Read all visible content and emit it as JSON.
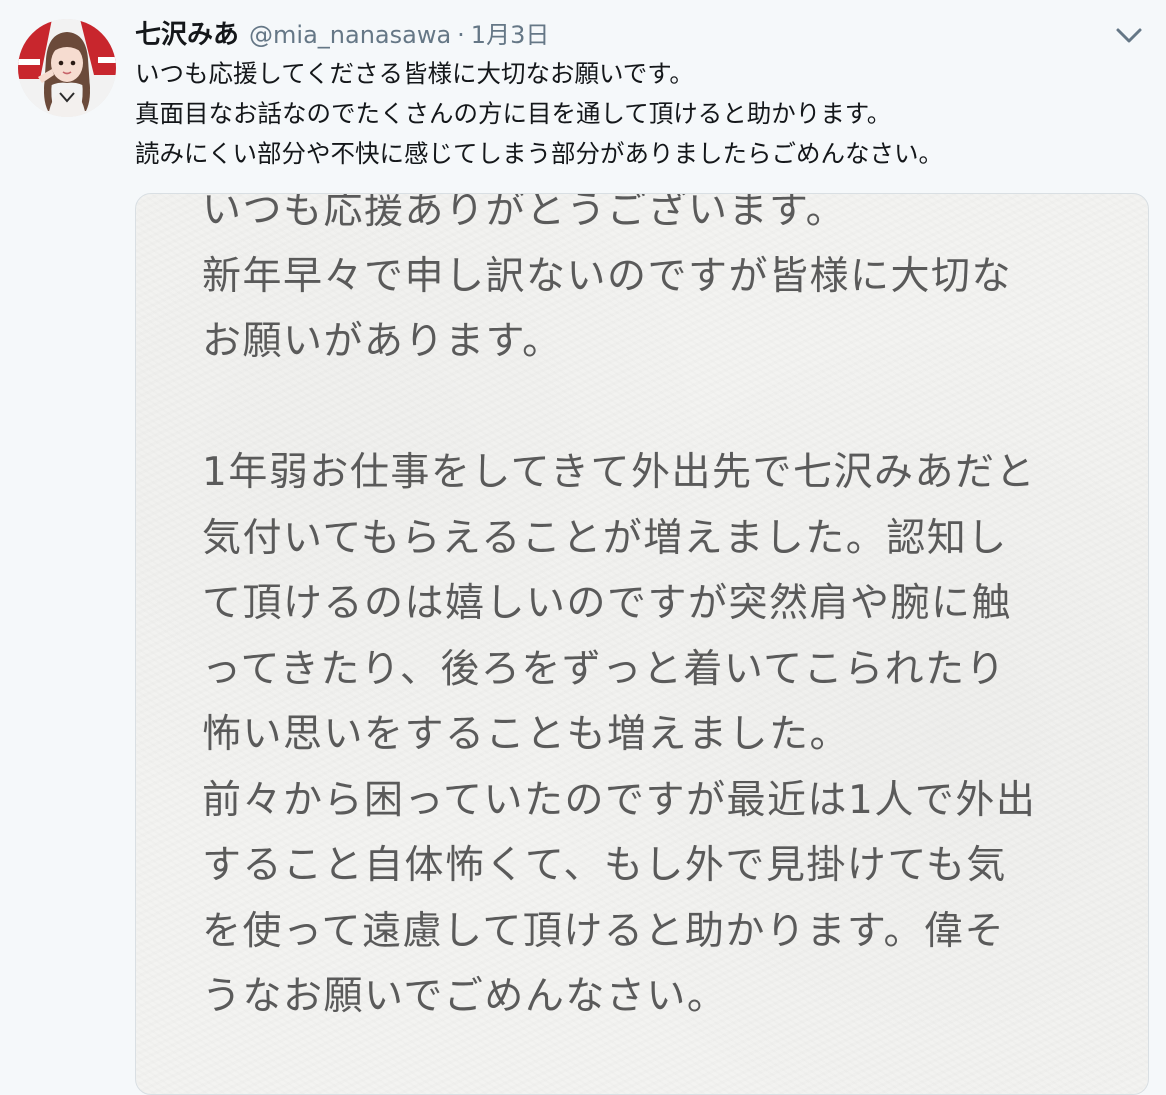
{
  "user": {
    "display_name": "七沢みあ",
    "handle": "@mia_nanasawa",
    "separator": "·",
    "timestamp": "1月3日"
  },
  "icons": {
    "avatar": "profile-avatar",
    "menu": "chevron-down-icon"
  },
  "tweet": {
    "lines": [
      "いつも応援してくださる皆様に大切なお願いです。",
      "真面目なお話なのでたくさんの方に目を通して頂けると助かります。",
      "読みにくい部分や不快に感じてしまう部分がありましたらごめんなさい。"
    ]
  },
  "image": {
    "lines": [
      "いつも応援ありがとうございます。",
      "新年早々で申し訳ないのですが皆様に大切な",
      "お願いがあります。",
      "",
      "1年弱お仕事をしてきて外出先で七沢みあだと",
      "気付いてもらえることが増えました。認知し",
      "て頂けるのは嬉しいのですが突然肩や腕に触",
      "ってきたり、後ろをずっと着いてこられたり",
      "怖い思いをすることも増えました。",
      "前々から困っていたのですが最近は1人で外出",
      "すること自体怖くて、もし外で見掛けても気",
      "を使って遠慮して頂けると助かります。偉そ",
      "うなお願いでごめんなさい。"
    ]
  },
  "colors": {
    "background": "#f5f8fa",
    "name": "#14171a",
    "muted": "#657786",
    "image_text": "#5a5a5a"
  }
}
